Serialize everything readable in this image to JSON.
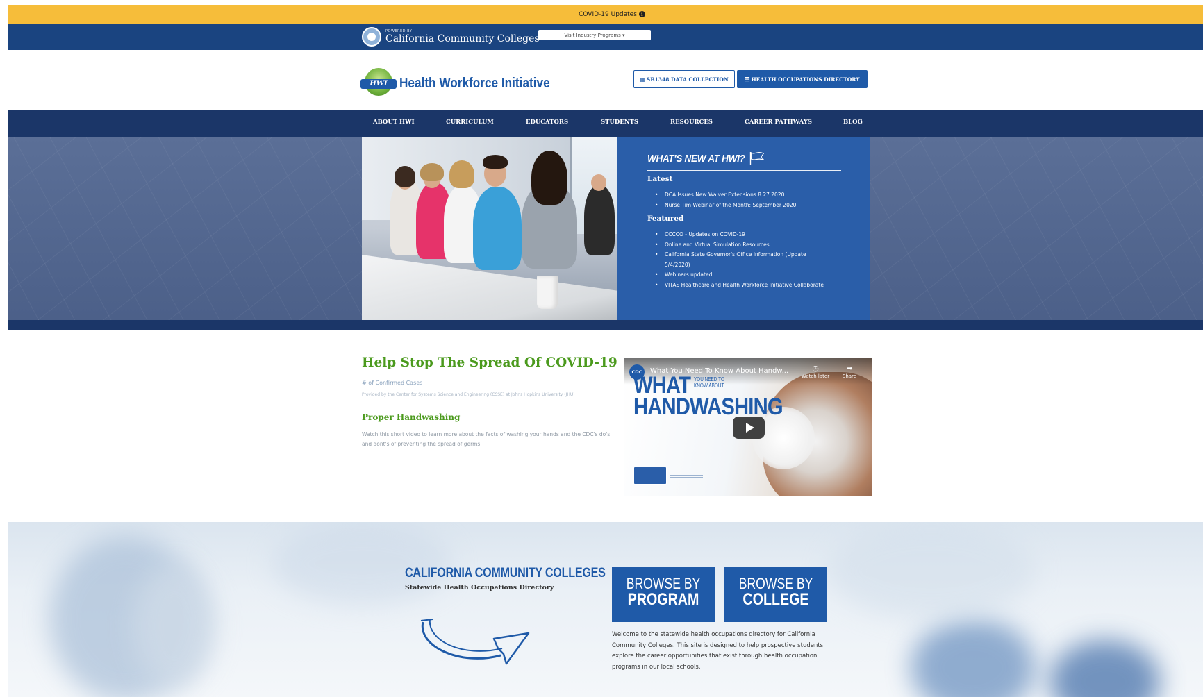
{
  "covid_bar": {
    "text": "COVID-19 Updates",
    "info_icon": "info-circle-icon"
  },
  "ccc_bar": {
    "powered_by": "POWERED BY",
    "org_name": "California Community Colleges",
    "select_value": "Visit Industry Programs ▾"
  },
  "header": {
    "logo_badge": "HWI",
    "site_title": "Health Workforce Initiative",
    "sb_button": "SB1348 DATA COLLECTION",
    "directory_button": "HEALTH OCCUPATIONS DIRECTORY"
  },
  "nav": {
    "items": [
      "ABOUT HWI",
      "CURRICULUM",
      "EDUCATORS",
      "STUDENTS",
      "RESOURCES",
      "CAREER PATHWAYS",
      "BLOG"
    ]
  },
  "news": {
    "title": "WHAT'S NEW AT HWI?",
    "latest_heading": "Latest",
    "latest": [
      "DCA Issues New Waiver Extensions 8 27 2020",
      "Nurse Tim Webinar of the Month: September 2020"
    ],
    "featured_heading": "Featured",
    "featured": [
      "CCCCO - Updates on COVID-19",
      "Online and Virtual Simulation Resources",
      "California State Governor's Office Information (Update 5/4/2020)",
      "Webinars updated",
      "VITAS Healthcare and Health Workforce Initiative Collaborate"
    ]
  },
  "covid_section": {
    "heading": "Help Stop The Spread Of COVID-19",
    "confirmed": "# of Confirmed Cases",
    "provided_by": "Provided by the Center for Systems Science and Engineering (CSSE) at Johns Hopkins University (JHU)",
    "handwashing_heading": "Proper Handwashing",
    "handwashing_text": "Watch this short video to learn more about the facts of washing your hands and the CDC's do's and dont's of preventing the spread of germs."
  },
  "video": {
    "channel_badge": "CDC",
    "title": "What You Need To Know About Handw...",
    "watch_later": "Watch later",
    "share": "Share",
    "thumb_what": "WHAT",
    "thumb_ynka": "YOU NEED TO",
    "thumb_ynkb": "KNOW ABOUT",
    "thumb_handwashing": "HANDWASHING"
  },
  "directory": {
    "heading": "CALIFORNIA COMMUNITY COLLEGES",
    "subheading": "Statewide Health Occupations Directory",
    "browse_program_l1": "BROWSE BY",
    "browse_program_l2": "PROGRAM",
    "browse_college_l1": "BROWSE BY",
    "browse_college_l2": "COLLEGE",
    "welcome": "Welcome to the statewide health occupations directory for California Community Colleges. This site is designed to help prospective students explore the career opportunities that exist through health occupation programs in our local schools."
  },
  "colors": {
    "covid_bar": "#f6bd3a",
    "ccc_blue": "#1a4480",
    "nav": "#1b3668",
    "accent_blue": "#1f5aa8",
    "green": "#4b9a1d"
  }
}
